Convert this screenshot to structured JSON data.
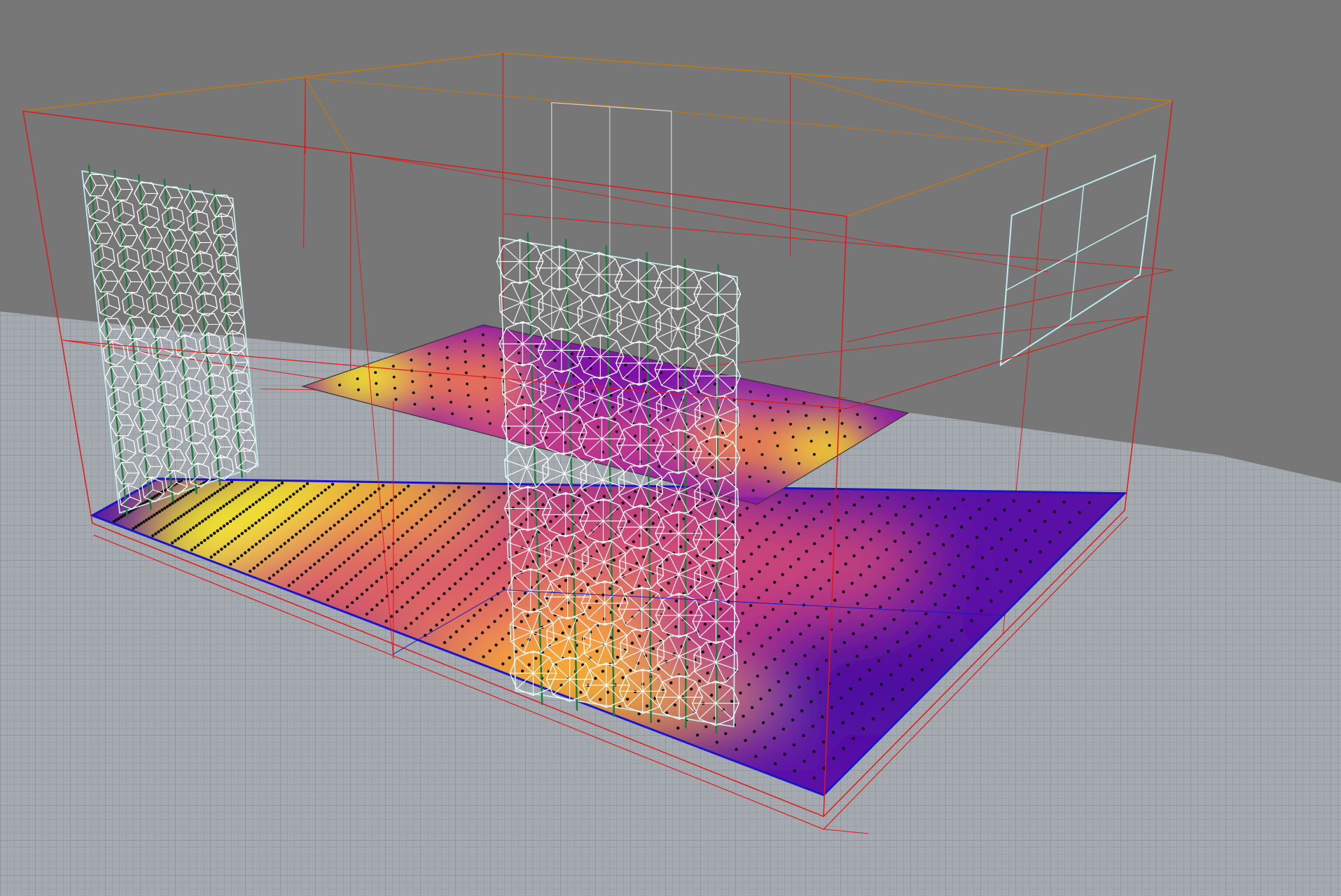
{
  "viewport": {
    "background": "#777777",
    "ground_grid_color": "#a7adb3",
    "ground_line_color": "#8b9197"
  },
  "room": {
    "frame_color": "#e01818",
    "top_edge_color": "#c8760a",
    "window_color": "#bfeeee"
  },
  "analysis": {
    "colormap": "plasma",
    "floor_border_color": "#1a14c8",
    "sensor_point_color": "#111111"
  },
  "louvers": {
    "module_color": "#ffffff",
    "stem_color": "#1d7a3c",
    "panel_color": "#bfeeee"
  }
}
